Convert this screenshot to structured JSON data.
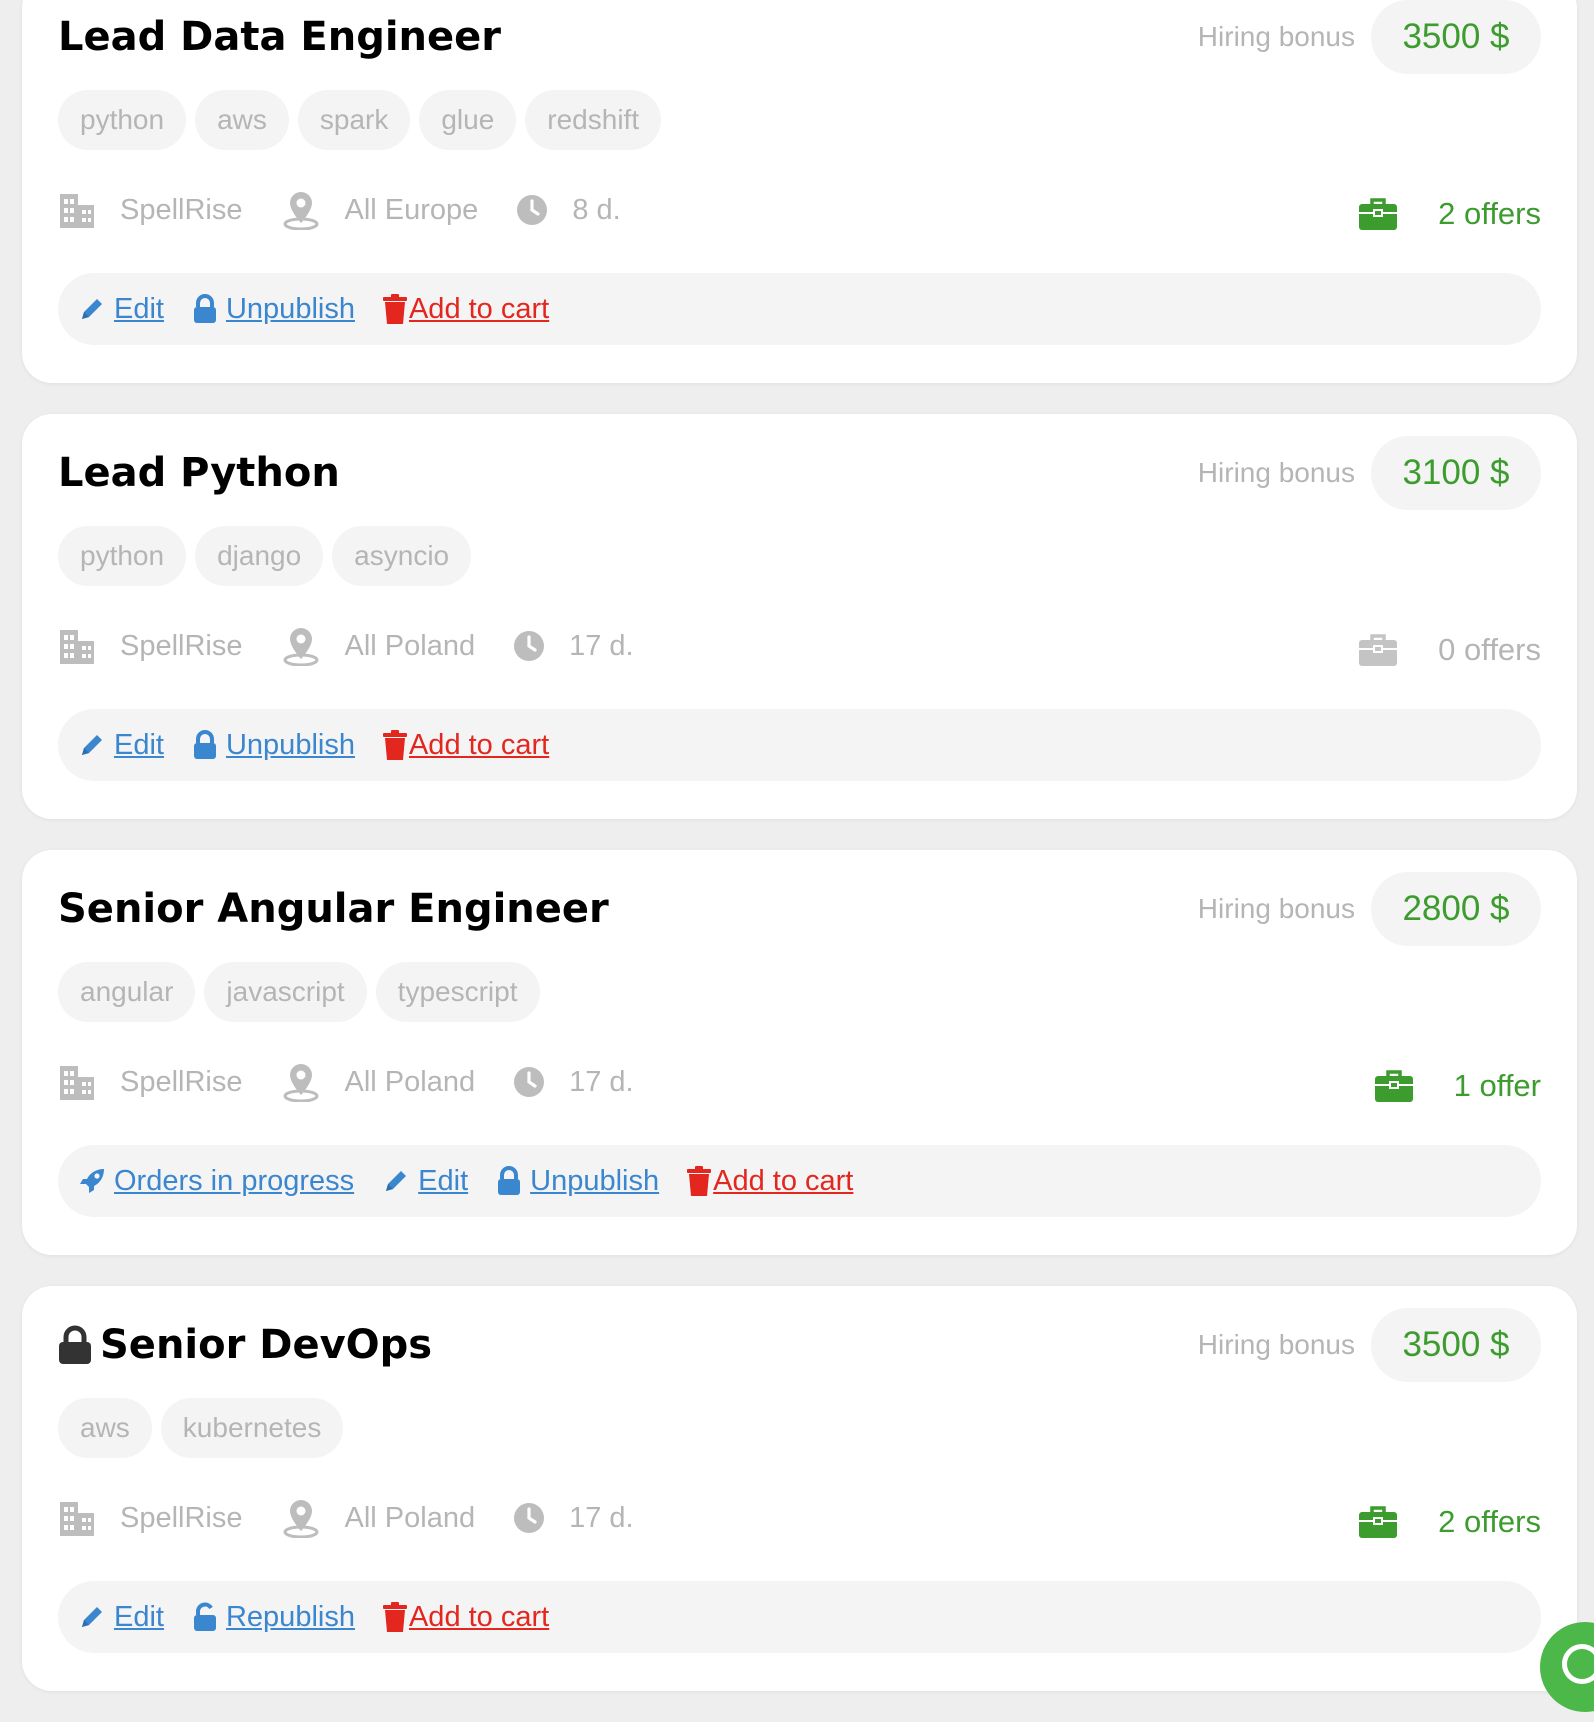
{
  "labels": {
    "hiring_bonus": "Hiring bonus"
  },
  "colors": {
    "green": "#3c9c2e",
    "link_blue": "#3a86cf",
    "cart_red": "#e3261e",
    "muted_gray": "#b5b5b5"
  },
  "jobs": [
    {
      "title": "Lead Data Engineer",
      "locked": false,
      "bonus": "3500 $",
      "tags": [
        "python",
        "aws",
        "spark",
        "glue",
        "redshift"
      ],
      "company": "SpellRise",
      "location": "All Europe",
      "age": "8 d.",
      "offers": "2 offers",
      "offers_active": true,
      "actions": [
        {
          "label": "Edit",
          "icon": "pencil-icon",
          "variant": "blue"
        },
        {
          "label": "Unpublish",
          "icon": "lock-icon",
          "variant": "blue"
        },
        {
          "label": "Add to cart",
          "icon": "trash-icon",
          "variant": "red"
        }
      ]
    },
    {
      "title": "Lead Python",
      "locked": false,
      "bonus": "3100 $",
      "tags": [
        "python",
        "django",
        "asyncio"
      ],
      "company": "SpellRise",
      "location": "All Poland",
      "age": "17 d.",
      "offers": "0 offers",
      "offers_active": false,
      "actions": [
        {
          "label": "Edit",
          "icon": "pencil-icon",
          "variant": "blue"
        },
        {
          "label": "Unpublish",
          "icon": "lock-icon",
          "variant": "blue"
        },
        {
          "label": "Add to cart",
          "icon": "trash-icon",
          "variant": "red"
        }
      ]
    },
    {
      "title": "Senior Angular Engineer",
      "locked": false,
      "bonus": "2800 $",
      "tags": [
        "angular",
        "javascript",
        "typescript"
      ],
      "company": "SpellRise",
      "location": "All Poland",
      "age": "17 d.",
      "offers": "1 offer",
      "offers_active": true,
      "actions": [
        {
          "label": "Orders in progress",
          "icon": "rocket-icon",
          "variant": "blue"
        },
        {
          "label": "Edit",
          "icon": "pencil-icon",
          "variant": "blue"
        },
        {
          "label": "Unpublish",
          "icon": "lock-icon",
          "variant": "blue"
        },
        {
          "label": "Add to cart",
          "icon": "trash-icon",
          "variant": "red"
        }
      ]
    },
    {
      "title": "Senior DevOps",
      "locked": true,
      "bonus": "3500 $",
      "tags": [
        "aws",
        "kubernetes"
      ],
      "company": "SpellRise",
      "location": "All Poland",
      "age": "17 d.",
      "offers": "2 offers",
      "offers_active": true,
      "actions": [
        {
          "label": "Edit",
          "icon": "pencil-icon",
          "variant": "blue"
        },
        {
          "label": "Republish",
          "icon": "unlock-icon",
          "variant": "blue"
        },
        {
          "label": "Add to cart",
          "icon": "trash-icon",
          "variant": "red"
        }
      ]
    }
  ]
}
